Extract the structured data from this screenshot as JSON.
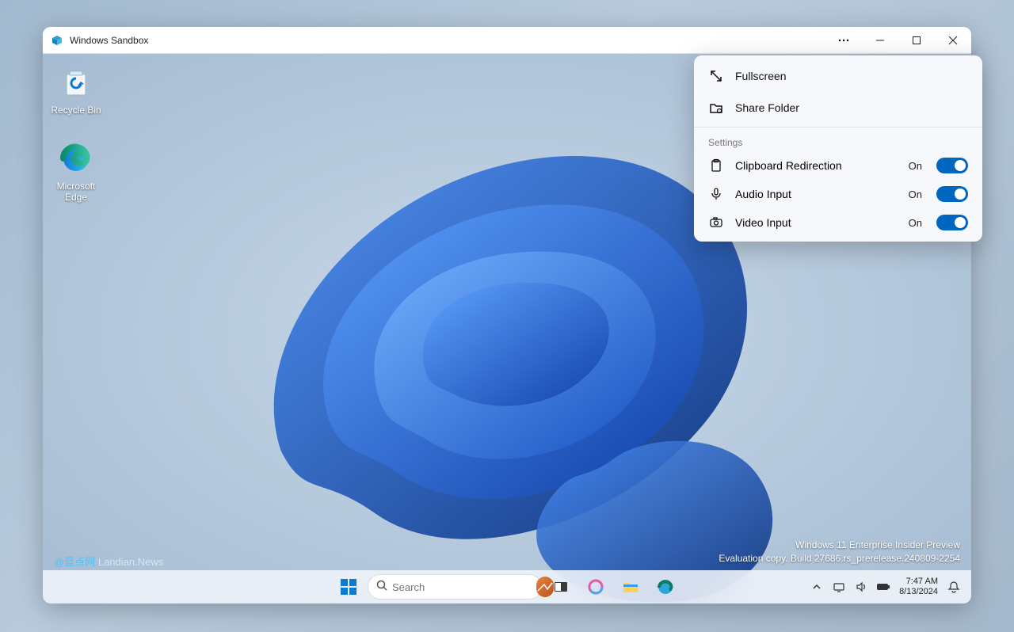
{
  "window": {
    "title": "Windows Sandbox"
  },
  "desktop_icons": {
    "recycle_bin": "Recycle Bin",
    "edge": "Microsoft Edge"
  },
  "flyout": {
    "fullscreen": "Fullscreen",
    "share_folder": "Share Folder",
    "settings_header": "Settings",
    "clipboard": {
      "label": "Clipboard Redirection",
      "state": "On"
    },
    "audio": {
      "label": "Audio Input",
      "state": "On"
    },
    "video": {
      "label": "Video Input",
      "state": "On"
    }
  },
  "taskbar": {
    "search_placeholder": "Search"
  },
  "watermark": {
    "line1": "Windows 11 Enterprise Insider Preview",
    "line2": "Evaluation copy. Build 27686.rs_prerelease.240809-2254"
  },
  "credit": {
    "handle": "@蓝点网",
    "site": "Landian.News"
  },
  "clock": {
    "time": "7:47 AM",
    "date": "8/13/2024"
  }
}
